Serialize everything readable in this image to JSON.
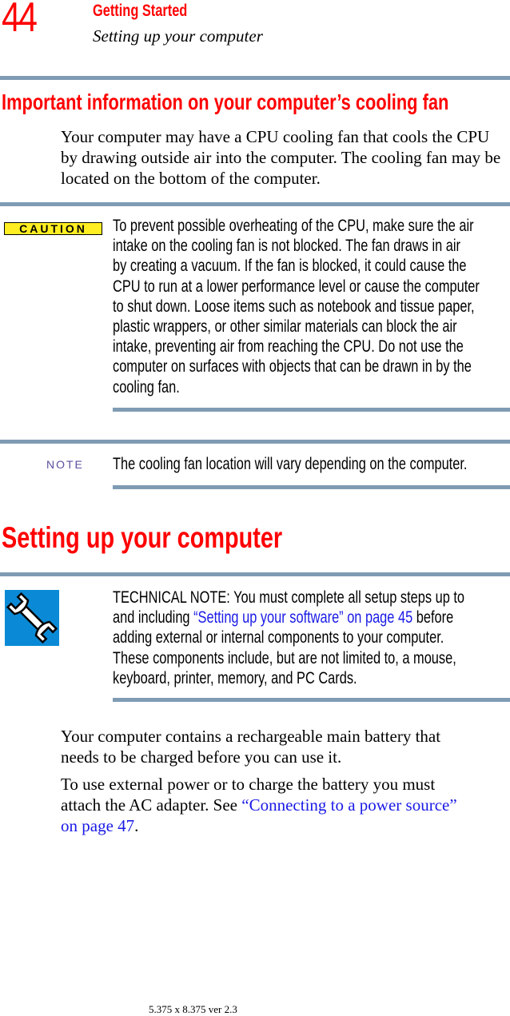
{
  "header": {
    "page_number": "44",
    "chapter_title": "Getting Started",
    "section_subtitle": "Setting up your computer"
  },
  "cooling_section": {
    "heading": "Important information on your computer’s cooling fan",
    "paragraph": "Your computer may have a CPU cooling fan that cools the CPU by drawing outside air into the computer. The cooling fan may be located on the bottom of the computer.",
    "caution": {
      "badge": "CAUTION",
      "lines": [
        "To prevent possible overheating of the CPU, make sure the air",
        "intake on the cooling fan is not blocked. The fan draws in air",
        "by creating a vacuum. If the fan is blocked, it could cause the",
        "CPU to run at a lower performance level or cause the computer",
        "to shut down. Loose items such as notebook and tissue paper,",
        "plastic wrappers, or other similar materials can block the air",
        "intake, preventing air from reaching the CPU. Do not use the",
        "computer on surfaces with objects that can be drawn in by the",
        "cooling fan."
      ]
    },
    "note": {
      "label": "NOTE",
      "text": "The cooling fan location will vary depending on the computer."
    }
  },
  "setup_section": {
    "heading": "Setting up your computer",
    "technical_note": {
      "line1": "TECHNICAL NOTE: You must complete all setup steps up to",
      "line2_prefix": "and including ",
      "line2_link": "“Setting up your software” on page 45",
      "line2_suffix": " before",
      "line3": "adding external or internal components to your computer.",
      "line4": "These components include, but are not limited to, a mouse,",
      "line5": "keyboard, printer, memory, and PC Cards."
    },
    "battery_paragraph": {
      "line1": "Your computer contains a rechargeable main battery that",
      "line2": "needs to be charged before you can use it."
    },
    "power_paragraph": {
      "line1": "To use external power or to charge the battery you must",
      "line2_prefix": "attach the AC adapter. See ",
      "line2_link": "“Connecting to a power source”",
      "line3_link": "on page 47",
      "line3_suffix": "."
    }
  },
  "footer": {
    "text": "5.375 x 8.375 ver 2.3"
  },
  "colors": {
    "heading_red": "#ff0000",
    "rule_blue_gray": "#7f9bb4",
    "link_blue": "#1a1ae6",
    "caution_yellow": "#ffee22",
    "note_purple": "#5a4fa0",
    "wrench_blue": "#0a8ad6"
  }
}
